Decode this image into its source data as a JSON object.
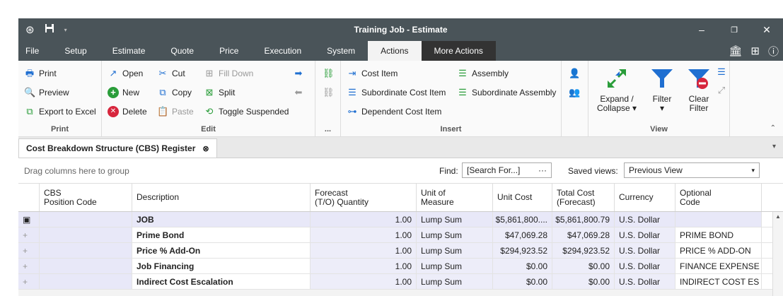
{
  "window": {
    "title": "Training Job - Estimate"
  },
  "menu": {
    "items": [
      "File",
      "Setup",
      "Estimate",
      "Quote",
      "Price",
      "Execution",
      "System",
      "Actions",
      "More Actions"
    ],
    "active": "Actions"
  },
  "ribbon": {
    "print": {
      "label": "Print",
      "print": "Print",
      "preview": "Preview",
      "export": "Export to Excel"
    },
    "edit": {
      "label": "Edit",
      "open": "Open",
      "cut": "Cut",
      "fill_down": "Fill Down",
      "new": "New",
      "copy": "Copy",
      "split": "Split",
      "delete": "Delete",
      "paste": "Paste",
      "toggle_suspended": "Toggle Suspended"
    },
    "more": {
      "label": "..."
    },
    "insert": {
      "label": "Insert",
      "cost_item": "Cost Item",
      "subordinate_cost_item": "Subordinate Cost Item",
      "dependent_cost_item": "Dependent Cost Item",
      "assembly": "Assembly",
      "subordinate_assembly": "Subordinate Assembly"
    },
    "view": {
      "label": "View",
      "expand_collapse_1": "Expand /",
      "expand_collapse_2": "Collapse",
      "filter": "Filter",
      "clear_filter_1": "Clear",
      "clear_filter_2": "Filter"
    }
  },
  "doc_tab": {
    "label": "Cost Breakdown Structure (CBS) Register"
  },
  "toolbar": {
    "group_hint": "Drag columns here to group",
    "find_label": "Find:",
    "find_placeholder": "[Search For...]",
    "saved_views_label": "Saved views:",
    "saved_view_value": "Previous View"
  },
  "grid": {
    "headers": {
      "cbs_1": "CBS",
      "cbs_2": "Position Code",
      "description": "Description",
      "qty_1": "Forecast",
      "qty_2": "(T/O) Quantity",
      "uom_1": "Unit of",
      "uom_2": "Measure",
      "unit_cost": "Unit Cost",
      "total_1": "Total Cost",
      "total_2": "(Forecast)",
      "currency": "Currency",
      "opt_1": "Optional",
      "opt_2": "Code"
    },
    "rows": [
      {
        "expander": "▣",
        "description": "JOB",
        "qty": "1.00",
        "uom": "Lump Sum",
        "unit_cost": "$5,861,800....",
        "total": "$5,861,800.79",
        "currency": "U.S. Dollar",
        "optional": ""
      },
      {
        "expander": "+",
        "description": "Prime Bond",
        "qty": "1.00",
        "uom": "Lump Sum",
        "unit_cost": "$47,069.28",
        "total": "$47,069.28",
        "currency": "U.S. Dollar",
        "optional": "PRIME BOND"
      },
      {
        "expander": "+",
        "description": "Price % Add-On",
        "qty": "1.00",
        "uom": "Lump Sum",
        "unit_cost": "$294,923.52",
        "total": "$294,923.52",
        "currency": "U.S. Dollar",
        "optional": "PRICE % ADD-ON"
      },
      {
        "expander": "+",
        "description": "Job Financing",
        "qty": "1.00",
        "uom": "Lump Sum",
        "unit_cost": "$0.00",
        "total": "$0.00",
        "currency": "U.S. Dollar",
        "optional": "FINANCE EXPENSE"
      },
      {
        "expander": "+",
        "description": "Indirect Cost Escalation",
        "qty": "1.00",
        "uom": "Lump Sum",
        "unit_cost": "$0.00",
        "total": "$0.00",
        "currency": "U.S. Dollar",
        "optional": "INDIRECT COST ES"
      }
    ]
  },
  "colors": {
    "titlebar": "#4a5459",
    "more_actions": "#333333",
    "accent_blue": "#1f6fd1",
    "accent_green": "#2a9d3a",
    "accent_red": "#d7263d"
  }
}
